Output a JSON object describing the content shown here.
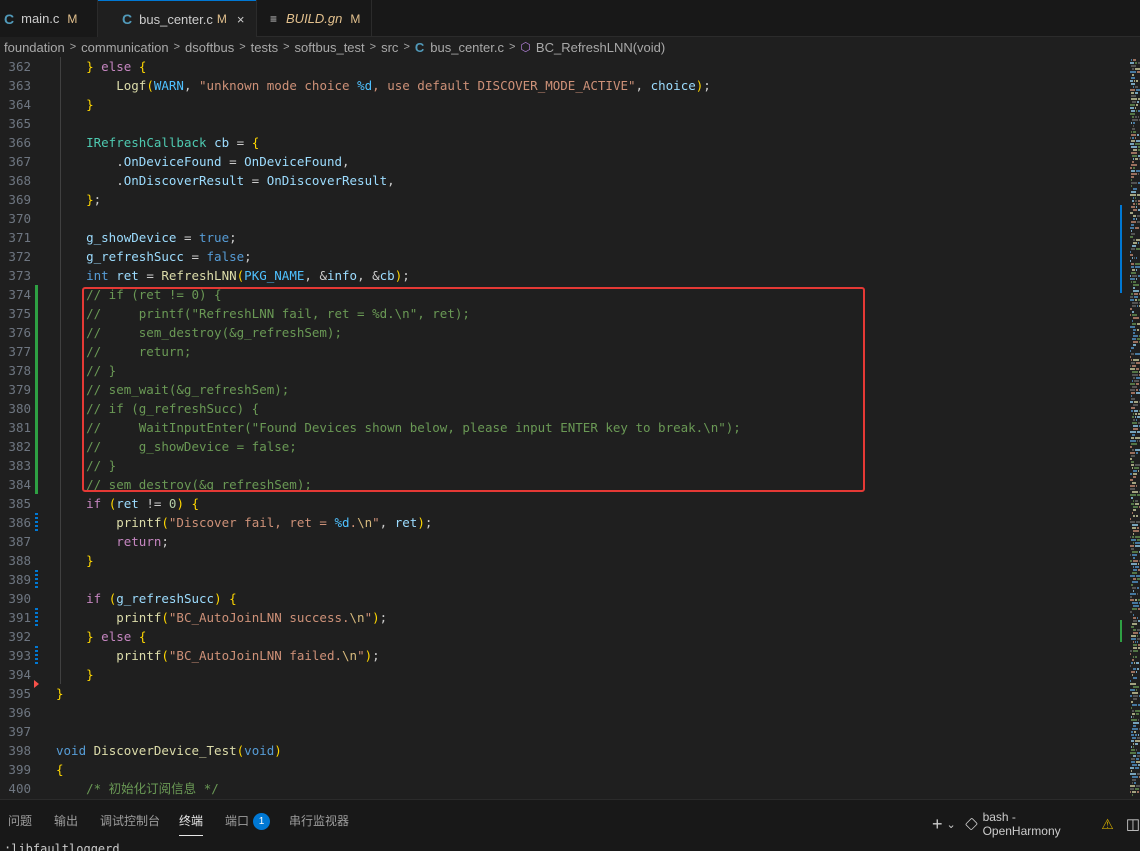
{
  "tabs": [
    {
      "icon": "C",
      "label": "main.c",
      "status": "M"
    },
    {
      "icon": "C",
      "label": "bus_center.c",
      "status": "M",
      "close": "×"
    },
    {
      "icon": "≡",
      "label": "BUILD.gn",
      "status": "M"
    }
  ],
  "breadcrumb": {
    "parts": [
      "foundation",
      "communication",
      "dsoftbus",
      "tests",
      "softbus_test",
      "src"
    ],
    "file_icon": "C",
    "file": "bus_center.c",
    "symbol_icon": "⬡",
    "symbol": "BC_RefreshLNN(void)",
    "separator": ">"
  },
  "editor": {
    "line_numbers": [
      "362",
      "363",
      "364",
      "365",
      "366",
      "367",
      "368",
      "369",
      "370",
      "371",
      "372",
      "373",
      "374",
      "375",
      "376",
      "377",
      "378",
      "379",
      "380",
      "381",
      "382",
      "383",
      "384",
      "385",
      "386",
      "387",
      "388",
      "389",
      "390",
      "391",
      "392",
      "393",
      "394",
      "395",
      "396",
      "397",
      "398",
      "399",
      "400"
    ],
    "lines": [
      "    } else {",
      "        Logf(WARN, \"unknown mode choice %d, use default DISCOVER_MODE_ACTIVE\", choice);",
      "    }",
      "",
      "    IRefreshCallback cb = {",
      "        .OnDeviceFound = OnDeviceFound,",
      "        .OnDiscoverResult = OnDiscoverResult,",
      "    };",
      "",
      "    g_showDevice = true;",
      "    g_refreshSucc = false;",
      "    int ret = RefreshLNN(PKG_NAME, &info, &cb);",
      "    // if (ret != 0) {",
      "    //     printf(\"RefreshLNN fail, ret = %d.\\n\", ret);",
      "    //     sem_destroy(&g_refreshSem);",
      "    //     return;",
      "    // }",
      "    // sem_wait(&g_refreshSem);",
      "    // if (g_refreshSucc) {",
      "    //     WaitInputEnter(\"Found Devices shown below, please input ENTER key to break.\\n\");",
      "    //     g_showDevice = false;",
      "    // }",
      "    // sem_destroy(&g_refreshSem);",
      "    if (ret != 0) {",
      "        printf(\"Discover fail, ret = %d.\\n\", ret);",
      "        return;",
      "    }",
      "",
      "    if (g_refreshSucc) {",
      "        printf(\"BC_AutoJoinLNN success.\\n\");",
      "    } else {",
      "        printf(\"BC_AutoJoinLNN failed.\\n\");",
      "    }",
      "}",
      "",
      "",
      "void DiscoverDevice_Test(void)",
      "{",
      "    /* 初始化订阅信息 */"
    ]
  },
  "panel": {
    "tabs": [
      "问题",
      "输出",
      "调试控制台",
      "终端",
      "端口",
      "串行监视器"
    ],
    "ports_badge": "1",
    "add_label": "+",
    "dropdown": "⌄",
    "terminal_name": "bash - OpenHarmony",
    "warning": "⚠",
    "split": "◫",
    "terminal_text": ":libfaultloggerd"
  },
  "colors": {
    "accent": "#0078d4",
    "highlight_box": "#e53935",
    "modified": "#e2c08d"
  }
}
